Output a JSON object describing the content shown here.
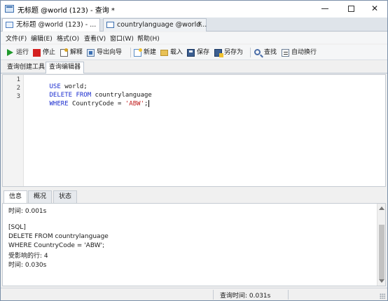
{
  "window": {
    "title": "无标题 @world (123) - 查询 *",
    "controls": {
      "minimize": "—",
      "maximize": "",
      "close": "✕"
    }
  },
  "doc_tabs": [
    {
      "label": "无标题 @world (123) - ...",
      "active": true,
      "icon": "query-icon"
    },
    {
      "label": "countrylanguage @world...",
      "active": false,
      "icon": "table-icon"
    }
  ],
  "doc_tab_close": "✕",
  "menu": [
    "文件(F)",
    "编辑(E)",
    "格式(O)",
    "查看(V)",
    "窗口(W)",
    "帮助(H)"
  ],
  "toolbar": {
    "run": "运行",
    "stop": "停止",
    "explain": "解释",
    "export_wizard": "导出向导",
    "new": "新建",
    "load": "载入",
    "save": "保存",
    "save_as": "另存为",
    "find": "查找",
    "word_wrap": "自动换行"
  },
  "sub_tabs": [
    "查询创建工具",
    "查询编辑器"
  ],
  "sub_tab_active": 1,
  "editor": {
    "line_numbers": [
      "1",
      "2",
      "3"
    ],
    "lines": [
      [
        {
          "t": "USE",
          "c": "kw"
        },
        {
          "t": " world;",
          "c": "id"
        }
      ],
      [
        {
          "t": "DELETE",
          "c": "kw"
        },
        {
          "t": " ",
          "c": "id"
        },
        {
          "t": "FROM",
          "c": "kw"
        },
        {
          "t": " countrylanguage",
          "c": "id"
        }
      ],
      [
        {
          "t": "WHERE",
          "c": "kw"
        },
        {
          "t": " CountryCode = ",
          "c": "id"
        },
        {
          "t": "'ABW'",
          "c": "str"
        },
        {
          "t": ";",
          "c": "id"
        }
      ]
    ]
  },
  "panel_tabs": [
    "信息",
    "概况",
    "状态"
  ],
  "panel_tab_active": 0,
  "output_lines": [
    "时间: 0.001s",
    "",
    "[SQL]",
    "DELETE FROM countrylanguage",
    "WHERE CountryCode = 'ABW';",
    "受影响的行: 4",
    "时间: 0.030s"
  ],
  "status": {
    "query_time": "查询时间: 0.031s"
  }
}
